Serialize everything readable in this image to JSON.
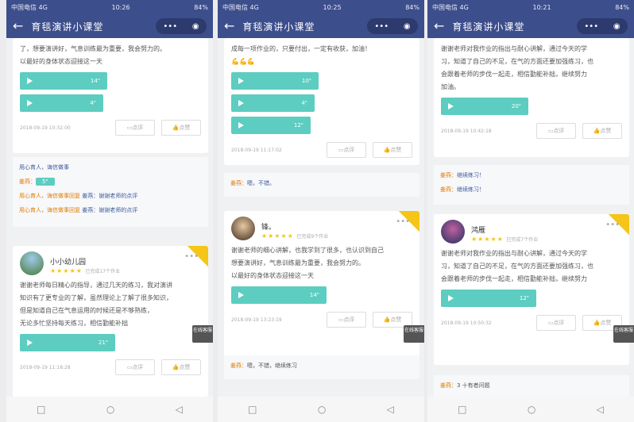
{
  "phones": [
    {
      "status_left": "中国电信 4G",
      "status_time": "10:26",
      "status_right": "84%",
      "nav_title": "育毯演讲小课堂",
      "card1_text_lines": [
        "了，想要演讲好，气息训练最为重要，我会努力的。",
        "以最好的身体状态迎接这一天"
      ],
      "card1_voices": [
        "14\"",
        "4\""
      ],
      "card1_date": "2018-09-19 10:32:00",
      "card1_comment_label": "点评",
      "card1_like_label": "点赞",
      "comment_lines": [
        {
          "who": "",
          "text": "用心育人，诲信做事"
        },
        {
          "who": "姜燕：",
          "text": "5\""
        },
        {
          "who": "用心育人，诲信做事回复 ",
          "text": "姜燕：谢谢老师的点评"
        },
        {
          "who": "用心育人，诲信做事回复 ",
          "text": "姜燕：谢谢老师的点评"
        }
      ],
      "card2_name": "小小幼儿园",
      "card2_stars": "★★★★★",
      "card2_count": "已完成17个作业",
      "card2_text_lines": [
        "谢谢老师每日精心的指导，通过几天的练习，我对演讲",
        "知识有了更专业的了解，虽然理论上了解了很多知识，",
        "但是知道自己在气息运用的时候还是不够熟练，",
        "无论多忙坚持每天练习，相信勤能补拙"
      ],
      "card2_voice": "21\"",
      "card2_date": "2018-09-19 11:18:28",
      "card2_comment_label": "点评",
      "card2_like_label": "点赞",
      "float_label": "在线客服"
    },
    {
      "status_left": "中国电信 4G",
      "status_time": "10:25",
      "status_right": "84%",
      "nav_title": "育毯演讲小课堂",
      "card1_text_lines": [
        "成每一项作业的，只要付出，一定有收获，加油！",
        "💪💪💪"
      ],
      "card1_voices": [
        "10\"",
        "4\"",
        "12\""
      ],
      "card1_date": "2018-09-19 11:17:02",
      "card1_comment_label": "点评",
      "card1_like_label": "点赞",
      "comment_lines": [
        {
          "who": "姜燕：",
          "text": "嗯，不错。"
        }
      ],
      "card2_name": "锋。",
      "card2_stars": "★★★★★",
      "card2_count": "已完成9个作业",
      "card2_text_lines": [
        "谢谢老师的细心讲解，也我学到了很多，也认识到自己",
        "想要演讲好，气息训练最为重要，我会努力的。",
        "以最好的身体状态迎接这一天"
      ],
      "card2_voice": "14\"",
      "card2_date": "2018-09-19 13:23:19",
      "card2_comment_label": "点评",
      "card2_like_label": "点赞",
      "comment2_lines": [
        {
          "who": "姜燕：",
          "text": "嗯，不错，继续练习"
        }
      ],
      "float_label": "在线客服"
    },
    {
      "status_left": "中国电信 4G",
      "status_time": "10:21",
      "status_right": "84%",
      "nav_title": "育毯演讲小课堂",
      "card1_text_lines": [
        "谢谢老师对我作业的指出与耐心讲解，通过今天的学",
        "习，知道了自己的不足，在气的方面还要加强练习，也",
        "会跟着老师的步伐一起走，相信勤能补拙，继续努力",
        "加油。"
      ],
      "card1_voices": [
        "20\""
      ],
      "card1_date": "2018-09-19 10:42:18",
      "card1_comment_label": "点评",
      "card1_like_label": "点赞",
      "comment_lines": [
        {
          "who": "姜燕：",
          "text": "继续练习！"
        },
        {
          "who": "姜燕：",
          "text": "继续练习！"
        }
      ],
      "card2_name": "鸿雁",
      "card2_stars": "★★★★★",
      "card2_count": "已完成7个作业",
      "card2_text_lines": [
        "谢谢老师对我作业的指出与耐心讲解，通过今天的学",
        "习，知道了自己的不足，在气的方面还要加强练习，也",
        "会跟着老师的步伐一起走，相信勤能补拙，继续努力"
      ],
      "card2_voice": "12\"",
      "card2_date": "2018-09-19 10:50:32",
      "card2_comment_label": "点评",
      "card2_like_label": "点赞",
      "comment2_lines": [
        {
          "who": "姜燕：",
          "text": "3 十有者问题"
        }
      ],
      "float_label": "在线客服"
    }
  ]
}
